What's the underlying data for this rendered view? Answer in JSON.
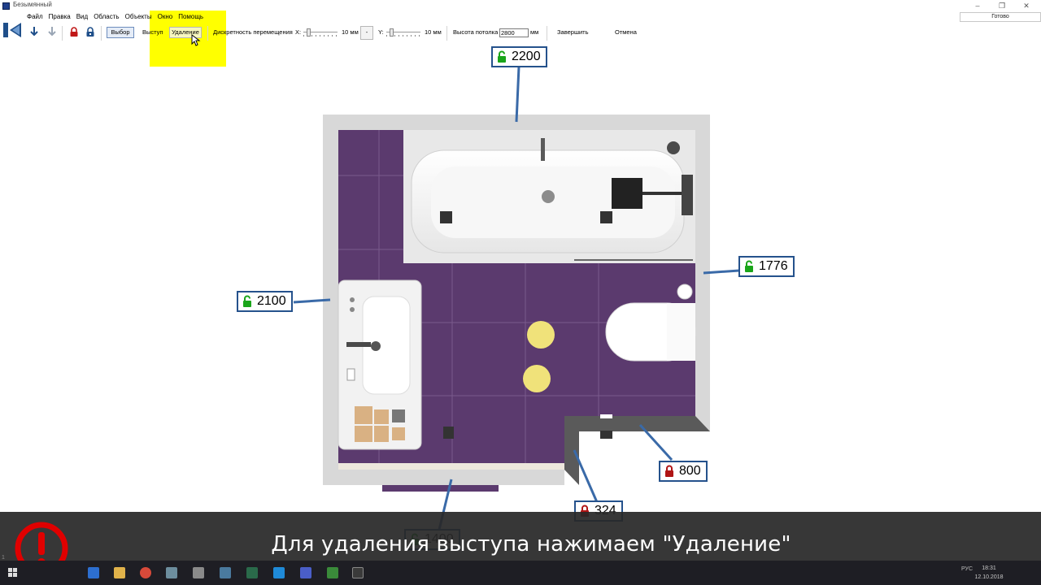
{
  "window": {
    "title": "Безымянный",
    "status": "Готово",
    "minimize": "–",
    "restore": "❐",
    "close": "✕"
  },
  "menu": [
    "Файл",
    "Правка",
    "Вид",
    "Область",
    "Объекты",
    "Окно",
    "Помощь"
  ],
  "toolbar": {
    "select_label": "Выбор",
    "protrusion_label": "Выступ",
    "delete_label": "Удаление",
    "discreteness_label": "Дискретность перемещения",
    "x_label": "X:",
    "x_value": "10 мм",
    "minus_label": "-",
    "y_label": "Y:",
    "y_value": "10 мм",
    "ceiling_label": "Высота потолка",
    "ceiling_value": "2800",
    "ceiling_unit": "мм",
    "finish_label": "Завершить",
    "cancel_label": "Отмена"
  },
  "dimensions": {
    "top": {
      "value": "2200",
      "locked": false
    },
    "right": {
      "value": "1776",
      "locked": false
    },
    "left": {
      "value": "2100",
      "locked": false
    },
    "bottom": {
      "value": "1400",
      "locked": false
    },
    "notch_right": {
      "value": "800",
      "locked": true
    },
    "notch_bottom": {
      "value": "324",
      "locked": true
    }
  },
  "subtitle": "Для удаления выступа нажимаем \"Удаление\"",
  "status_line": "1",
  "taskbar": {
    "lang": "РУС",
    "time": "18:31",
    "date": "12.10.2018"
  },
  "colors": {
    "highlight": "#ffff00",
    "floor": "#5b3a6e",
    "wall": "#d6d6d6",
    "dim_border": "#25528c",
    "unlocked": "#1aa51a",
    "locked": "#b01515",
    "warning": "#e00000"
  }
}
